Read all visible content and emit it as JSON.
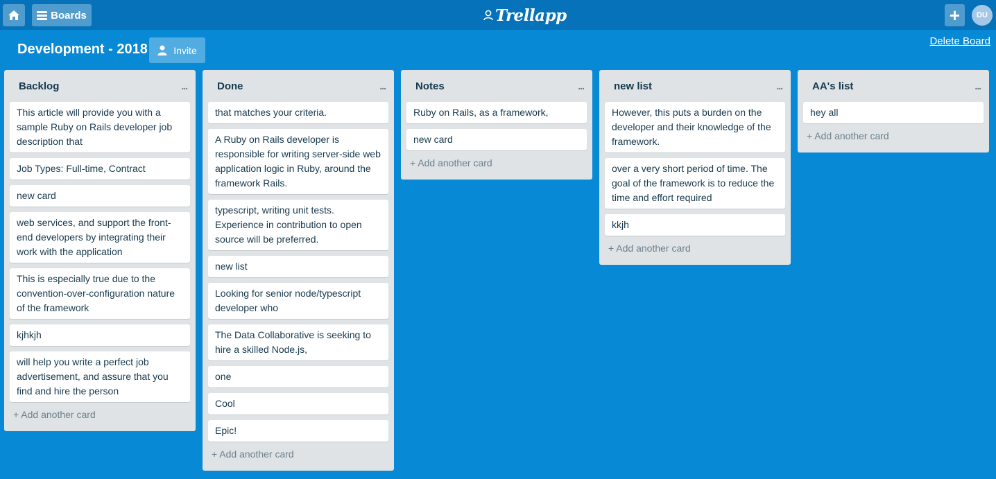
{
  "topbar": {
    "boards_label": "Boards",
    "logo_text": "Trellapp",
    "plus_label": "+",
    "avatar_initials": "DU"
  },
  "board": {
    "title": "Development - 2018",
    "invite_label": "Invite",
    "delete_label": "Delete Board"
  },
  "lists": [
    {
      "title": "Backlog",
      "menu": "...",
      "add_label": "+ Add another card",
      "cards": [
        "This article will provide you with a sample Ruby on Rails developer job description that",
        "Job Types: Full-time, Contract",
        "new card",
        "web services, and support the front-end developers by integrating their work with the application",
        "This is especially true due to the convention-over-configuration nature of the framework",
        "kjhkjh",
        "will help you write a perfect job advertisement, and assure that you find and hire the person"
      ]
    },
    {
      "title": "Done",
      "menu": "...",
      "add_label": "+ Add another card",
      "cards": [
        "that matches your criteria.",
        "A Ruby on Rails developer is responsible for writing server-side web application logic in Ruby, around the framework Rails.",
        "typescript, writing unit tests. Experience in contribution to open source will be preferred.",
        "new list",
        "Looking for senior node/typescript developer who",
        "The Data Collaborative is seeking to hire a skilled Node.js,",
        "one",
        "Cool",
        "Epic!"
      ]
    },
    {
      "title": "Notes",
      "menu": "...",
      "add_label": "+ Add another card",
      "cards": [
        "Ruby on Rails, as a framework,",
        "new card"
      ]
    },
    {
      "title": "new list",
      "menu": "...",
      "add_label": "+ Add another card",
      "cards": [
        "However, this puts a burden on the developer and their knowledge of the framework.",
        "over a very short period of time. The goal of the framework is to reduce the time and effort required",
        "kkjh"
      ]
    },
    {
      "title": "AA's list",
      "menu": "...",
      "add_label": "+ Add another card",
      "cards": [
        "hey all"
      ]
    }
  ]
}
